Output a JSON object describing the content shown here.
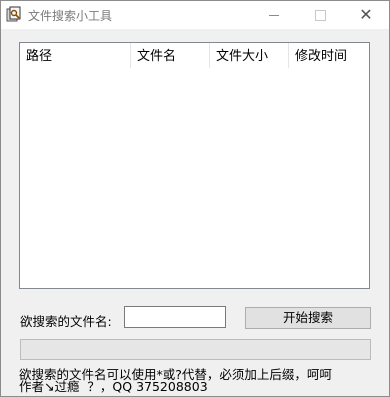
{
  "window": {
    "title": "文件搜索小工具",
    "controls": {
      "minimize": "minimize-icon",
      "maximize": "maximize-icon",
      "close": "close-icon"
    }
  },
  "listview": {
    "columns": [
      {
        "label": "路径"
      },
      {
        "label": "文件名"
      },
      {
        "label": "文件大小"
      },
      {
        "label": "修改时间"
      }
    ],
    "rows": []
  },
  "search": {
    "label": "欲搜索的文件名:",
    "value": "",
    "button_label": "开始搜索"
  },
  "progress": {
    "value": 0
  },
  "hint_text": "欲搜索的文件名可以使用*或?代替，必须加上后缀，呵呵\n作者↘过瘾  ？，QQ 375208803"
}
